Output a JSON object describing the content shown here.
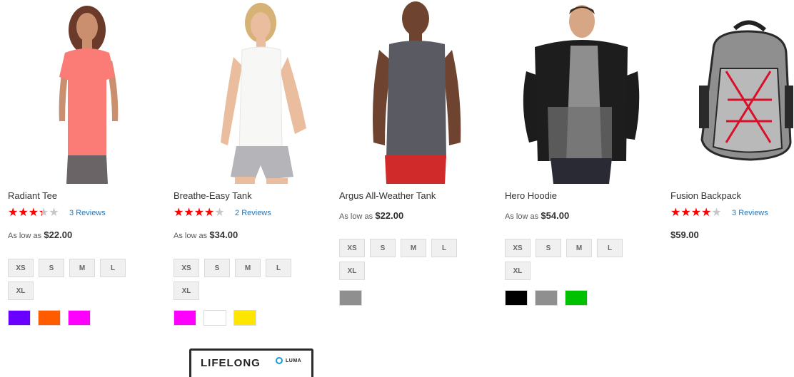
{
  "products": [
    {
      "name": "Radiant Tee",
      "rating_stars": 3,
      "rating_fraction": 0.6,
      "reviews_label": "Reviews",
      "reviews_count": "3",
      "price_label": "As low as",
      "price": "$22.00",
      "sizes": [
        "XS",
        "S",
        "M",
        "L",
        "XL"
      ],
      "colors": [
        "#6a00ff",
        "#ff5c00",
        "#ff00ff"
      ]
    },
    {
      "name": "Breathe-Easy Tank",
      "rating_stars": 3.5,
      "rating_fraction": 0.7,
      "reviews_label": "Reviews",
      "reviews_count": "2",
      "price_label": "As low as",
      "price": "$34.00",
      "sizes": [
        "XS",
        "S",
        "M",
        "L",
        "XL"
      ],
      "colors": [
        "#ff00ff",
        "#ffffff",
        "#ffe600"
      ]
    },
    {
      "name": "Argus All-Weather Tank",
      "price_label": "As low as",
      "price": "$22.00",
      "sizes": [
        "XS",
        "S",
        "M",
        "L",
        "XL"
      ],
      "colors": [
        "#8f8f8f"
      ]
    },
    {
      "name": "Hero Hoodie",
      "price_label": "As low as",
      "price": "$54.00",
      "sizes": [
        "XS",
        "S",
        "M",
        "L",
        "XL"
      ],
      "colors": [
        "#000000",
        "#8f8f8f",
        "#00c100"
      ]
    },
    {
      "name": "Fusion Backpack",
      "rating_stars": 3.5,
      "rating_fraction": 0.7,
      "reviews_label": "Reviews",
      "reviews_count": "3",
      "price": "$59.00"
    }
  ],
  "banner": {
    "word": "LIFELONG",
    "logo_text": "LUMA"
  },
  "colors": {
    "star_filled": "#ff0000",
    "star_empty": "#c7c7c7",
    "link": "#1979c3"
  }
}
